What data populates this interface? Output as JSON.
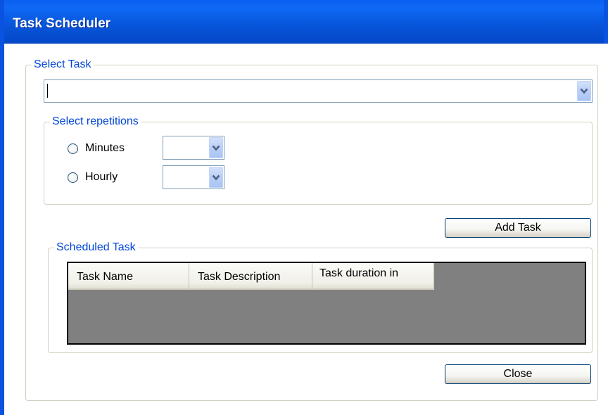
{
  "window": {
    "title": "Task Scheduler"
  },
  "select_task": {
    "legend": "Select Task",
    "combo_value": ""
  },
  "repetitions": {
    "legend": "Select repetitions",
    "options": [
      {
        "label": "Minutes",
        "selected": false,
        "value": ""
      },
      {
        "label": "Hourly",
        "selected": false,
        "value": ""
      }
    ]
  },
  "buttons": {
    "add_task": "Add Task",
    "close": "Close"
  },
  "scheduled": {
    "legend": "Scheduled Task",
    "columns": [
      "Task Name",
      "Task Description",
      "Task duration in"
    ],
    "rows": []
  },
  "colors": {
    "titlebar": "#0856dc",
    "legend_text": "#0046d5",
    "grid_background": "#808080"
  },
  "icons": {
    "dropdown": "chevron-down-icon",
    "radio": "radio-button"
  }
}
